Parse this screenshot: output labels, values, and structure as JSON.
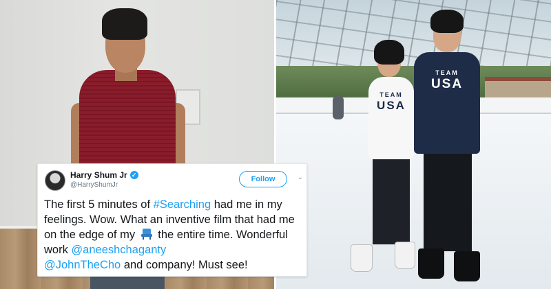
{
  "tweet": {
    "display_name": "Harry Shum Jr",
    "verified_mark": "✓",
    "handle": "@HarryShumJr",
    "follow_label": "Follow",
    "caret": "⌄",
    "text": {
      "p1": "The first 5 minutes of ",
      "hashtag": "#Searching",
      "p2": " had me in my feelings. Wow. What an inventive film that had me on the edge of my ",
      "emoji_name": "seat-icon",
      "p3": " the entire time.  Wonderful work ",
      "mention1": "@aneeshchaganty",
      "mention2": "@JohnTheCho",
      "p4": " and company! Must see!"
    },
    "colors": {
      "link": "#1da1f2",
      "text": "#14171a",
      "secondary": "#657786"
    }
  },
  "photo_right": {
    "shirt_f": {
      "line1": "TEAM",
      "line2": "USA"
    },
    "shirt_m": {
      "line1": "TEAM",
      "line2": "USA"
    }
  }
}
